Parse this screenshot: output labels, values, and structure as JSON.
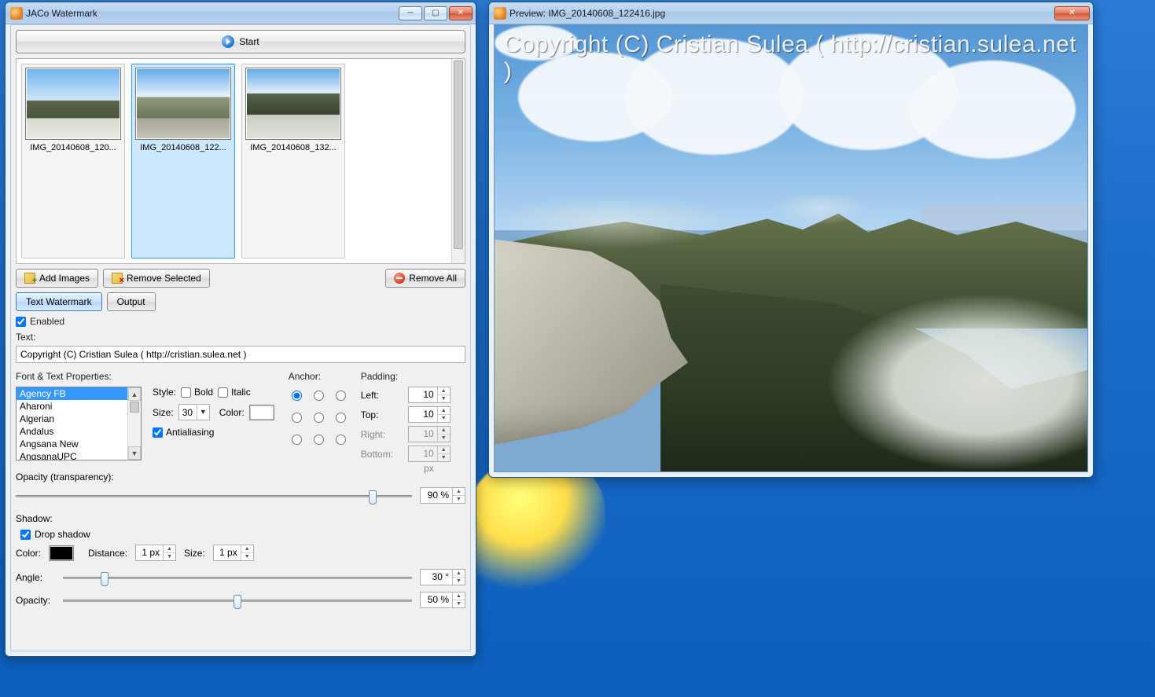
{
  "main": {
    "title": "JACo Watermark",
    "start": "Start",
    "thumbnails": [
      {
        "label": "IMG_20140608_120..."
      },
      {
        "label": "IMG_20140608_122..."
      },
      {
        "label": "IMG_20140608_132..."
      }
    ],
    "buttons": {
      "add": "Add Images",
      "remove_selected": "Remove Selected",
      "remove_all": "Remove All"
    },
    "tabs": {
      "text_watermark": "Text Watermark",
      "output": "Output"
    },
    "enabled_label": "Enabled",
    "enabled_checked": true,
    "text_label": "Text:",
    "text_value": "Copyright (C) Cristian Sulea ( http://cristian.sulea.net )",
    "font_group": "Font & Text Properties:",
    "fonts": [
      "Agency FB",
      "Aharoni",
      "Algerian",
      "Andalus",
      "Angsana New",
      "AngsanaUPC"
    ],
    "font_selected_index": 0,
    "style_label": "Style:",
    "bold_label": "Bold",
    "italic_label": "Italic",
    "size_label": "Size:",
    "size_value": "30",
    "color_label": "Color:",
    "antialias_label": "Antialiasing",
    "antialias_checked": true,
    "anchor_label": "Anchor:",
    "anchor_selected": 0,
    "padding_label": "Padding:",
    "pad": {
      "left": {
        "label": "Left:",
        "value": "10 px",
        "disabled": false
      },
      "top": {
        "label": "Top:",
        "value": "10 px",
        "disabled": false
      },
      "right": {
        "label": "Right:",
        "value": "10 px",
        "disabled": true
      },
      "bottom": {
        "label": "Bottom:",
        "value": "10 px",
        "disabled": true
      }
    },
    "opacity_label": "Opacity (transparency):",
    "opacity_value": "90 %",
    "opacity_pos_pct": 90,
    "shadow_group": "Shadow:",
    "drop_shadow_label": "Drop shadow",
    "drop_shadow_checked": true,
    "shadow_color_label": "Color:",
    "distance_label": "Distance:",
    "distance_value": "1 px",
    "shadow_size_label": "Size:",
    "shadow_size_value": "1 px",
    "angle_label": "Angle:",
    "angle_value": "30 °",
    "angle_pos_pct": 12,
    "shadow_opacity_label": "Opacity:",
    "shadow_opacity_value": "50 %",
    "shadow_opacity_pos_pct": 50
  },
  "preview": {
    "title": "Preview: IMG_20140608_122416.jpg",
    "watermark_text": "Copyright (C) Cristian Sulea ( http://cristian.sulea.net )"
  }
}
